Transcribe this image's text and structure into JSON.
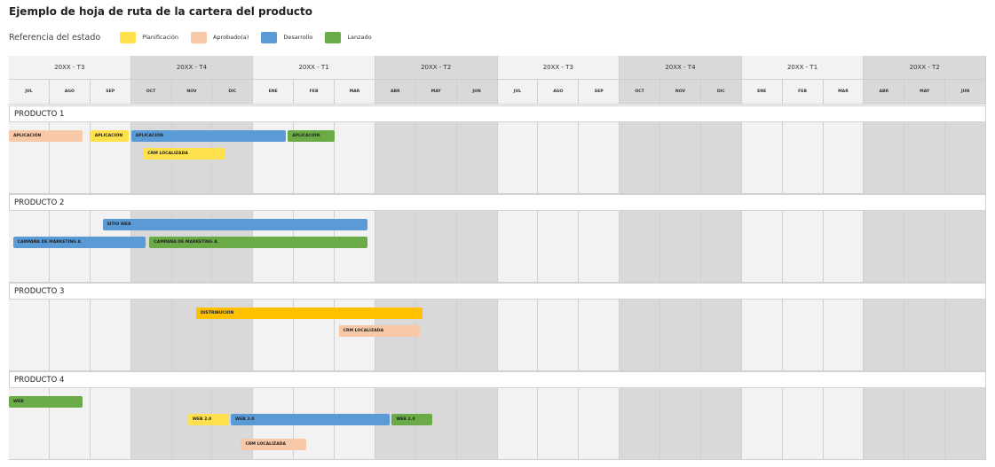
{
  "title": "Ejemplo de hoja de ruta de la cartera del producto",
  "legend": {
    "label": "Referencia del estado",
    "items": [
      {
        "key": "planificacion",
        "label": "Planificación",
        "color": "#FFE14D"
      },
      {
        "key": "aprobado",
        "label": "Aprobado(a)",
        "color": "#F8C9A8"
      },
      {
        "key": "desarrollo",
        "label": "Desarrollo",
        "color": "#5B9BD5"
      },
      {
        "key": "lanzado",
        "label": "Lanzado",
        "color": "#6AAB47"
      }
    ]
  },
  "colors": {
    "distribucion": "#FFC000",
    "quarter_dark": "#d9d9d9",
    "quarter_light": "#f2f2f2"
  },
  "chart_data": {
    "type": "gantt",
    "quarters": [
      {
        "label": "20XX - T3",
        "months": 3,
        "shade": "light"
      },
      {
        "label": "20XX - T4",
        "months": 3,
        "shade": "dark"
      },
      {
        "label": "20XX - T1",
        "months": 3,
        "shade": "light"
      },
      {
        "label": "20XX - T2",
        "months": 3,
        "shade": "dark"
      },
      {
        "label": "20XX - T3",
        "months": 3,
        "shade": "light"
      },
      {
        "label": "20XX - T4",
        "months": 3,
        "shade": "dark"
      },
      {
        "label": "20XX - T1",
        "months": 3,
        "shade": "light"
      },
      {
        "label": "20XX - T2",
        "months": 3,
        "shade": "dark"
      }
    ],
    "months": [
      "JUL",
      "AGO",
      "SEP",
      "OCT",
      "NOV",
      "DIC",
      "ENE",
      "FEB",
      "MAR",
      "ABR",
      "MAY",
      "JUN",
      "JUL",
      "AGO",
      "SEP",
      "OCT",
      "NOV",
      "DIC",
      "ENE",
      "FEB",
      "MAR",
      "ABR",
      "MAY",
      "JUN"
    ],
    "products": [
      {
        "name": "PRODUCTO 1",
        "tasks": [
          {
            "label": "APLICACIÓN",
            "status": "aprobado",
            "start": 0.0,
            "end": 1.8,
            "lane": 0
          },
          {
            "label": "APLICACIÓN",
            "status": "planificacion",
            "start": 2.0,
            "end": 2.95,
            "lane": 0
          },
          {
            "label": "APLICACIÓN",
            "status": "desarrollo",
            "start": 3.0,
            "end": 6.8,
            "lane": 0
          },
          {
            "label": "APLICACIÓN",
            "status": "lanzado",
            "start": 6.85,
            "end": 8.0,
            "lane": 0
          },
          {
            "label": "CRM LOCALIZADA",
            "status": "planificacion",
            "start": 3.3,
            "end": 5.3,
            "lane": 1
          }
        ]
      },
      {
        "name": "PRODUCTO 2",
        "tasks": [
          {
            "label": "SITIO WEB",
            "status": "desarrollo",
            "start": 2.3,
            "end": 8.8,
            "lane": 0
          },
          {
            "label": "CAMPAÑA DE MARKETING A",
            "status": "desarrollo",
            "start": 0.1,
            "end": 3.35,
            "lane": 1
          },
          {
            "label": "CAMPAÑA DE MARKETING A",
            "status": "lanzado",
            "start": 3.45,
            "end": 8.8,
            "lane": 1
          }
        ]
      },
      {
        "name": "PRODUCTO 3",
        "tasks": [
          {
            "label": "DISTRIBUCIÓN",
            "status": "distribucion",
            "start": 4.6,
            "end": 10.15,
            "lane": 0
          },
          {
            "label": "CRM LOCALIZADA",
            "status": "aprobado",
            "start": 8.1,
            "end": 10.1,
            "lane": 1
          }
        ]
      },
      {
        "name": "PRODUCTO 4",
        "tasks": [
          {
            "label": "WEB",
            "status": "lanzado",
            "start": 0.0,
            "end": 1.8,
            "lane": 0
          },
          {
            "label": "WEB 2.0",
            "status": "planificacion",
            "start": 4.4,
            "end": 5.4,
            "lane": 1
          },
          {
            "label": "WEB 2.0",
            "status": "desarrollo",
            "start": 5.45,
            "end": 9.35,
            "lane": 1
          },
          {
            "label": "WEB 2.0",
            "status": "lanzado",
            "start": 9.4,
            "end": 10.4,
            "lane": 1
          },
          {
            "label": "CRM LOCALIZADA",
            "status": "aprobado",
            "start": 5.7,
            "end": 7.3,
            "lane": 2
          }
        ]
      }
    ]
  }
}
